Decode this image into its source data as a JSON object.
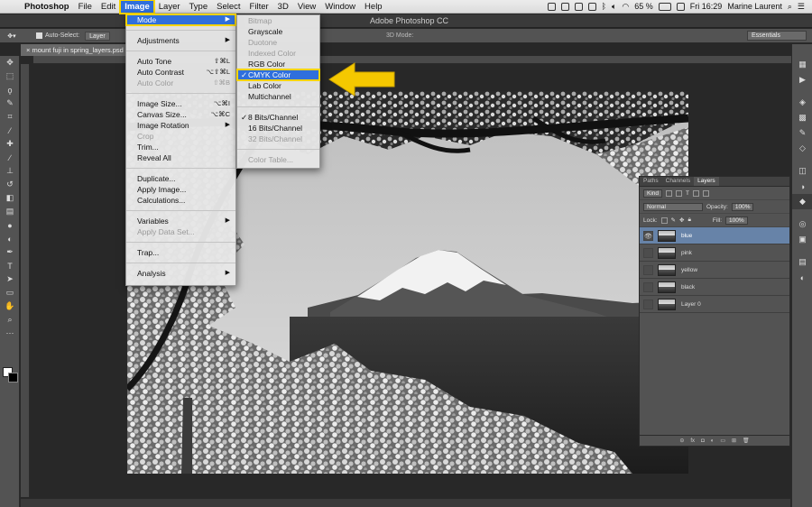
{
  "menubar": {
    "app_name": "Photoshop",
    "items": [
      "File",
      "Edit",
      "Image",
      "Layer",
      "Type",
      "Select",
      "Filter",
      "3D",
      "View",
      "Window",
      "Help"
    ],
    "active_item": "Image",
    "battery": "65 %",
    "clock": "Fri 16:29",
    "user": "Marine Laurent"
  },
  "window": {
    "title": "Adobe Photoshop CC"
  },
  "options_bar": {
    "auto_select_label": "Auto-Select:",
    "auto_select_value": "Layer",
    "mode_3d_label": "3D Mode:",
    "workspace": "Essentials"
  },
  "document": {
    "tab_title": "mount fuji in spring_layers.psd"
  },
  "image_menu": {
    "mode": "Mode",
    "adjustments": "Adjustments",
    "auto_tone": "Auto Tone",
    "auto_tone_sc": "⇧⌘L",
    "auto_contrast": "Auto Contrast",
    "auto_contrast_sc": "⌥⇧⌘L",
    "auto_color": "Auto Color",
    "auto_color_sc": "⇧⌘B",
    "image_size": "Image Size...",
    "image_size_sc": "⌥⌘I",
    "canvas_size": "Canvas Size...",
    "canvas_size_sc": "⌥⌘C",
    "image_rotation": "Image Rotation",
    "crop": "Crop",
    "trim": "Trim...",
    "reveal_all": "Reveal All",
    "duplicate": "Duplicate...",
    "apply_image": "Apply Image...",
    "calculations": "Calculations...",
    "variables": "Variables",
    "apply_data_set": "Apply Data Set...",
    "trap": "Trap...",
    "analysis": "Analysis"
  },
  "mode_menu": {
    "bitmap": "Bitmap",
    "grayscale": "Grayscale",
    "duotone": "Duotone",
    "indexed_color": "Indexed Color",
    "rgb_color": "RGB Color",
    "cmyk_color": "CMYK Color",
    "lab_color": "Lab Color",
    "multichannel": "Multichannel",
    "bits8": "8 Bits/Channel",
    "bits16": "16 Bits/Channel",
    "bits32": "32 Bits/Channel",
    "color_table": "Color Table..."
  },
  "layers_panel": {
    "tabs": [
      "Paths",
      "Channels",
      "Layers"
    ],
    "active_tab": "Layers",
    "filter": "Kind",
    "blend_mode": "Normal",
    "opacity_label": "Opacity:",
    "opacity": "100%",
    "lock_label": "Lock:",
    "fill_label": "Fill:",
    "fill": "100%",
    "layers": [
      {
        "name": "blue",
        "visible": true,
        "selected": true
      },
      {
        "name": "pink",
        "visible": false,
        "selected": false
      },
      {
        "name": "yellow",
        "visible": false,
        "selected": false
      },
      {
        "name": "black",
        "visible": false,
        "selected": false
      },
      {
        "name": "Layer 0",
        "visible": false,
        "selected": false
      }
    ]
  },
  "colors": {
    "accent": "#2f6fdc",
    "highlight": "#f5d400",
    "panel": "#535353",
    "selected_layer": "#6783a8"
  }
}
